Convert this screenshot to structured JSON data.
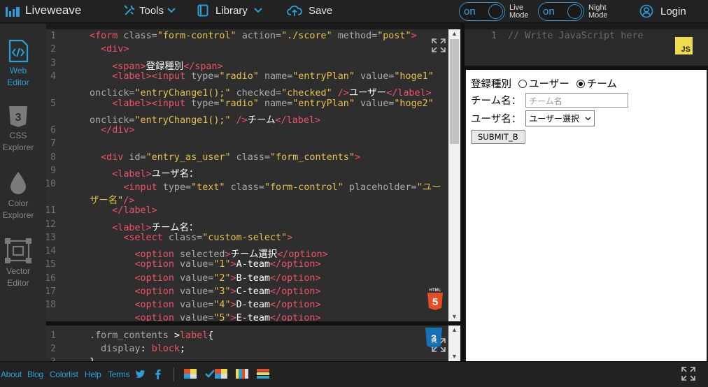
{
  "app": {
    "logo_text": "Liveweave"
  },
  "menu": {
    "tools": "Tools",
    "library": "Library",
    "save": "Save",
    "login": "Login"
  },
  "toggles": [
    {
      "state": "on",
      "label_line1": "Live",
      "label_line2": "Mode"
    },
    {
      "state": "on",
      "label_line1": "Night",
      "label_line2": "Mode"
    }
  ],
  "sidebar": {
    "items": [
      {
        "line1": "Web",
        "line2": "Editor",
        "active": true
      },
      {
        "line1": "CSS",
        "line2": "Explorer",
        "active": false
      },
      {
        "line1": "Color",
        "line2": "Explorer",
        "active": false
      },
      {
        "line1": "Vector",
        "line2": "Editor",
        "active": false
      }
    ]
  },
  "html_editor": {
    "line_numbers": [
      "1",
      "2",
      "3",
      "4",
      "5",
      "6",
      "7",
      "8",
      "9",
      "10",
      "11",
      "12",
      "13",
      "14",
      "15",
      "16",
      "17",
      "18"
    ]
  },
  "css_editor": {
    "line_numbers": [
      "1",
      "2",
      "3"
    ]
  },
  "js_editor": {
    "line_numbers": [
      "1"
    ],
    "code": "// Write JavaScript here",
    "badge": "JS"
  },
  "preview": {
    "entry_label": "登録種別",
    "radio_user": "ユーザー",
    "radio_team": "チーム",
    "radio_checked": "team",
    "team_name_label": "チーム名：",
    "team_name_placeholder": "チーム名",
    "user_name_label": "ユーザ名：",
    "user_select_value": "ユーザー選択",
    "submit_label": "SUBMIT_B"
  },
  "footer": {
    "links": [
      "About",
      "Blog",
      "Colorlist",
      "Help",
      "Terms"
    ]
  },
  "colors": {
    "accent": "#2a9fd6",
    "tag": "#f0526a",
    "string": "#e7c04d",
    "editor_bg": "#2e2e2e"
  }
}
